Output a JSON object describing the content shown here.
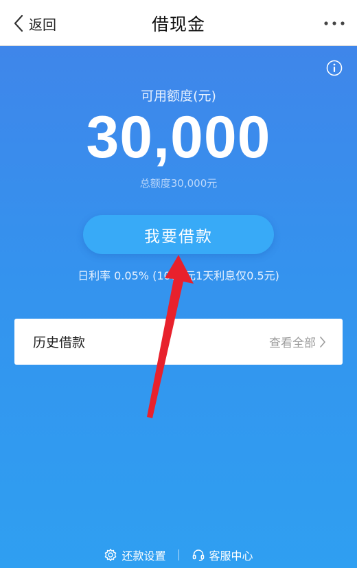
{
  "nav": {
    "back_label": "返回",
    "title": "借现金"
  },
  "quota": {
    "available_label": "可用额度(元)",
    "available_amount": "30,000",
    "total_text": "总额度30,000元"
  },
  "borrow_button": "我要借款",
  "rate_text": "日利率 0.05% (1000元1天利息仅0.5元)",
  "history": {
    "title": "历史借款",
    "view_all": "查看全部"
  },
  "footer": {
    "repay_settings": "还款设置",
    "customer_service": "客服中心"
  },
  "icons": {
    "back": "chevron-left-icon",
    "more": "more-dots-icon",
    "info": "info-icon",
    "view_all": "chevron-right-icon",
    "repay_settings": "gear-icon",
    "customer_service": "headset-icon"
  },
  "colors": {
    "background_top": "#3f86ea",
    "background_bottom": "#2f9ff1",
    "button": "#38aaf7",
    "annotation_arrow": "#e8212c"
  }
}
